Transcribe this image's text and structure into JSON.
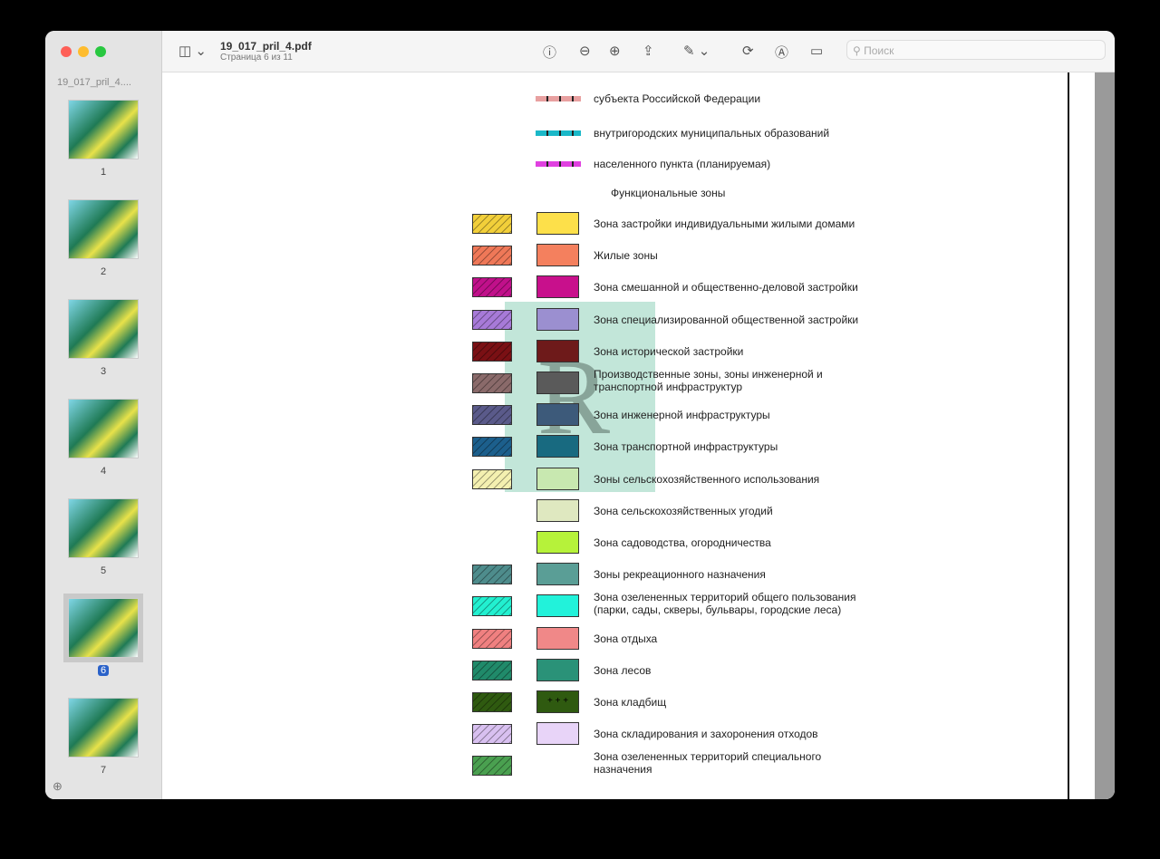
{
  "window": {
    "title": "19_017_pril_4.pdf",
    "subtitle": "Страница 6 из 11",
    "search_placeholder": "Поиск"
  },
  "sidebar": {
    "title": "19_017_pril_4....",
    "pages": [
      "1",
      "2",
      "3",
      "4",
      "5",
      "6",
      "7"
    ],
    "selected": "6"
  },
  "toolbar": {
    "icons": [
      "sidebar-toggle-icon",
      "info-icon",
      "zoom-out-icon",
      "zoom-in-icon",
      "share-icon",
      "markup-pen-icon",
      "rotate-icon",
      "annotate-icon",
      "form-icon",
      "search-icon"
    ]
  },
  "legend": {
    "lines": [
      {
        "label": "субъекта Российской Федерации",
        "color": "#e8a0a0"
      },
      {
        "label": "внутригородских муниципальных образований",
        "color": "#1ab8c8"
      },
      {
        "label": "населенного пункта (планируемая)",
        "color": "#e040e0"
      }
    ],
    "section_title": "Функциональные зоны",
    "zones": [
      {
        "label": "Зона застройки индивидуальными жилыми домами",
        "hatch": "#f2cf3a",
        "solid": "#fde04a"
      },
      {
        "label": "Жилые зоны",
        "hatch": "#ef7858",
        "solid": "#f4805e"
      },
      {
        "label": "Зона смешанной и общественно-деловой застройки",
        "hatch": "#c0108a",
        "solid": "#c8108c"
      },
      {
        "label": "Зона специализированной общественной застройки",
        "hatch": "#a77ad8",
        "solid": "#9b8fd0"
      },
      {
        "label": "Зона исторической застройки",
        "hatch": "#7a1014",
        "solid": "#6e1a1a"
      },
      {
        "label": "Производственные зоны, зоны инженерной и транспортной инфраструктур",
        "hatch": "#8a6a6a",
        "solid": "#5a5a5a"
      },
      {
        "label": "Зона инженерной инфраструктуры",
        "hatch": "#5a5a8a",
        "solid": "#3d5a7a"
      },
      {
        "label": "Зона транспортной инфраструктуры",
        "hatch": "#1c5f8c",
        "solid": "#186a80"
      },
      {
        "label": "Зоны сельскохозяйственного использования",
        "hatch": "#f4f0b0",
        "solid": "#c8e8b0"
      },
      {
        "label": "Зона сельскохозяйственных угодий",
        "hatch": null,
        "solid": "#dfe8c0"
      },
      {
        "label": "Зона садоводства, огородничества",
        "hatch": null,
        "solid": "#b6f23a"
      },
      {
        "label": "Зоны рекреационного назначения",
        "hatch": "#4e8c8c",
        "solid": "#5a9e96"
      },
      {
        "label": "Зона озелененных территорий общего пользования (парки, сады, скверы, бульвары, городские леса)",
        "hatch": "#22f0d0",
        "solid": "#22f2da"
      },
      {
        "label": "Зона отдыха",
        "hatch": "#f08080",
        "solid": "#f08888"
      },
      {
        "label": "Зона лесов",
        "hatch": "#208a6a",
        "solid": "#2a9278"
      },
      {
        "label": "Зона кладбищ",
        "hatch": "#2f5a10",
        "solid": "#2f5a10"
      },
      {
        "label": "Зона складирования и захоронения отходов",
        "hatch": "#d8c0f0",
        "solid": "#e8d4f8"
      },
      {
        "label": "Зона озелененных территорий специального назначения",
        "hatch": "#4aa050",
        "solid": null
      }
    ]
  }
}
